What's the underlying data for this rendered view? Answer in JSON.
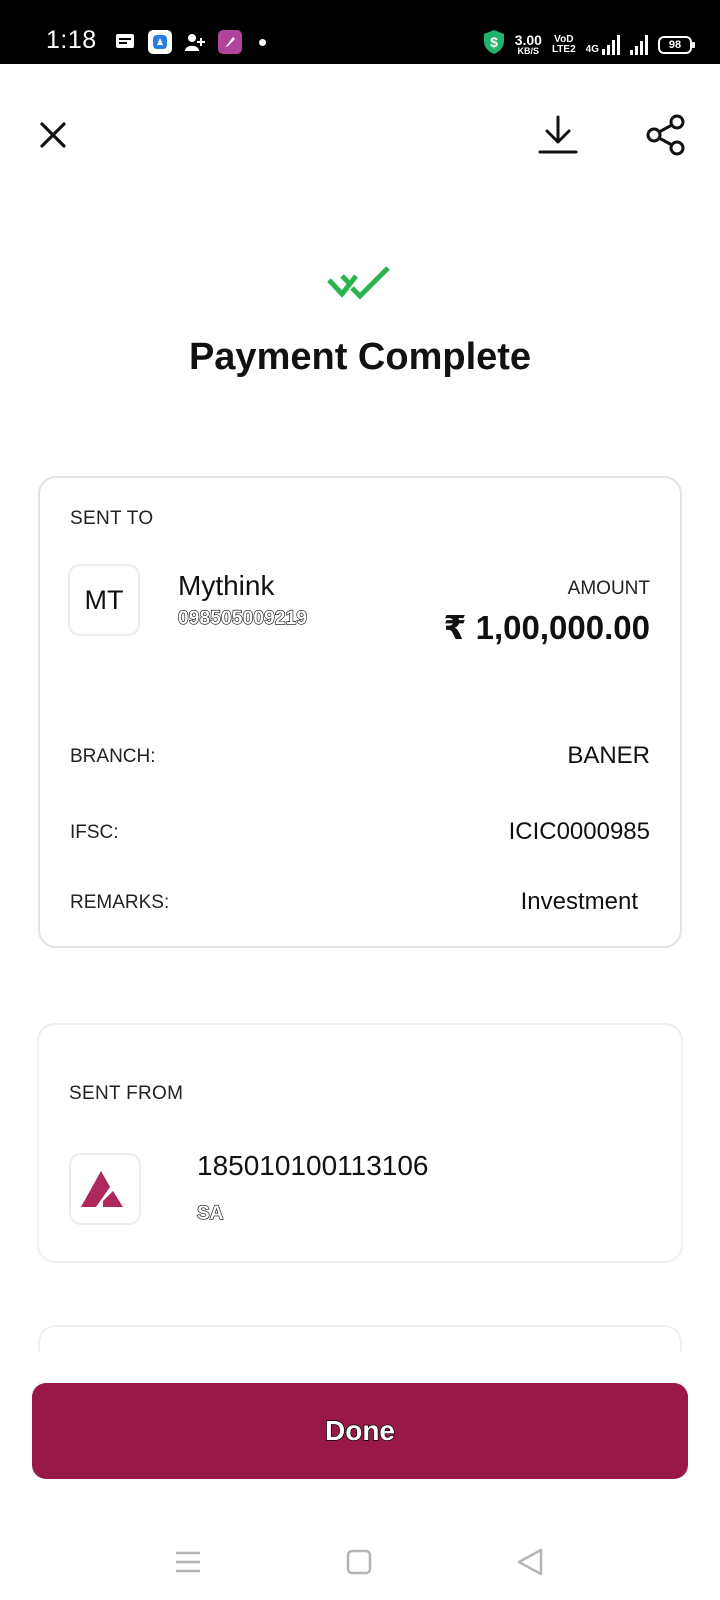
{
  "status_bar": {
    "time": "1:18",
    "net_speed_value": "3.00",
    "net_speed_unit": "KB/S",
    "volte_top": "VoD",
    "volte_bottom": "LTE2",
    "network": "4G",
    "battery": "98"
  },
  "header": {
    "close_icon": "close-icon",
    "download_icon": "download-icon",
    "share_icon": "share-icon"
  },
  "title": "Payment Complete",
  "accent_color": "#981848",
  "success_color": "#2bb54f",
  "sent_to": {
    "label": "SENT TO",
    "avatar_initials": "MT",
    "name": "Mythink",
    "account": "098505009219",
    "amount_label": "AMOUNT",
    "amount": "₹ 1,00,000.00",
    "details": [
      {
        "label": "BRANCH:",
        "value": "BANER"
      },
      {
        "label": "IFSC:",
        "value": "ICIC0000985"
      },
      {
        "label": "REMARKS:",
        "value": "Investment"
      }
    ]
  },
  "sent_from": {
    "label": "SENT FROM",
    "bank_icon": "axis-bank-logo",
    "account_number": "185010100113106",
    "account_type": "SA"
  },
  "done_label": "Done",
  "nav": {
    "menu_icon": "menu-icon",
    "home_icon": "home-square-icon",
    "back_icon": "back-triangle-icon"
  }
}
